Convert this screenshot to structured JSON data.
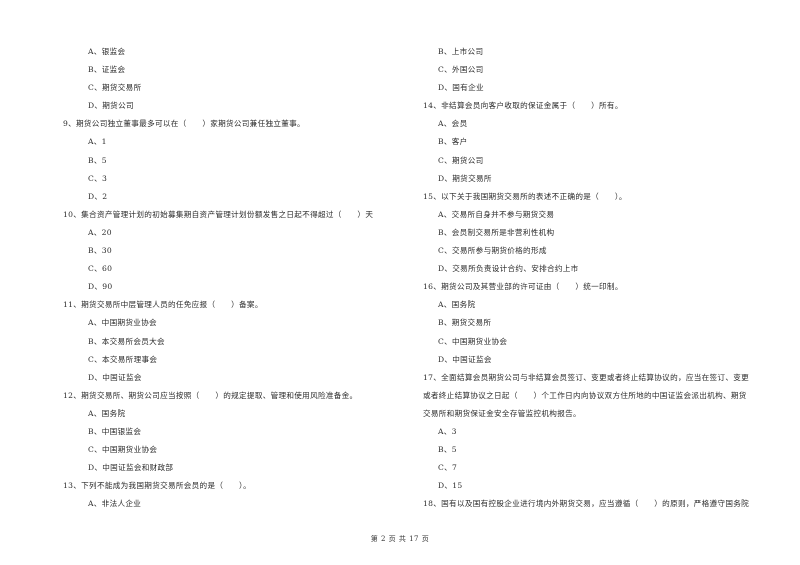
{
  "left_column": [
    {
      "type": "opt",
      "text": "A、银监会"
    },
    {
      "type": "opt",
      "text": "B、证监会"
    },
    {
      "type": "opt",
      "text": "C、期货交易所"
    },
    {
      "type": "opt",
      "text": "D、期货公司"
    },
    {
      "type": "q",
      "text": "9、期货公司独立董事最多可以在（　　）家期货公司兼任独立董事。"
    },
    {
      "type": "opt",
      "text": "A、1"
    },
    {
      "type": "opt",
      "text": "B、5"
    },
    {
      "type": "opt",
      "text": "C、3"
    },
    {
      "type": "opt",
      "text": "D、2"
    },
    {
      "type": "q",
      "text": "10、集合资产管理计划的初始募集期自资产管理计划份额发售之日起不得超过（　　）天"
    },
    {
      "type": "opt",
      "text": "A、20"
    },
    {
      "type": "opt",
      "text": "B、30"
    },
    {
      "type": "opt",
      "text": "C、60"
    },
    {
      "type": "opt",
      "text": "D、90"
    },
    {
      "type": "q",
      "text": "11、期货交易所中层管理人员的任免应报（　　）备案。"
    },
    {
      "type": "opt",
      "text": "A、中国期货业协会"
    },
    {
      "type": "opt",
      "text": "B、本交易所会员大会"
    },
    {
      "type": "opt",
      "text": "C、本交易所理事会"
    },
    {
      "type": "opt",
      "text": "D、中国证监会"
    },
    {
      "type": "q",
      "text": "12、期货交易所、期货公司应当按照（　　）的规定提取、管理和使用风险准备金。"
    },
    {
      "type": "opt",
      "text": "A、国务院"
    },
    {
      "type": "opt",
      "text": "B、中国银监会"
    },
    {
      "type": "opt",
      "text": "C、中国期货业协会"
    },
    {
      "type": "opt",
      "text": "D、中国证监会和财政部"
    },
    {
      "type": "q",
      "text": "13、下列不能成为我国期货交易所会员的是（　　）。"
    },
    {
      "type": "opt",
      "text": "A、非法人企业"
    }
  ],
  "right_column": [
    {
      "type": "opt",
      "text": "B、上市公司"
    },
    {
      "type": "opt",
      "text": "C、外国公司"
    },
    {
      "type": "opt",
      "text": "D、国有企业"
    },
    {
      "type": "q",
      "text": "14、非结算会员向客户收取的保证金属于（　　）所有。"
    },
    {
      "type": "opt",
      "text": "A、会员"
    },
    {
      "type": "opt",
      "text": "B、客户"
    },
    {
      "type": "opt",
      "text": "C、期货公司"
    },
    {
      "type": "opt",
      "text": "D、期货交易所"
    },
    {
      "type": "q",
      "text": "15、以下关于我国期货交易所的表述不正确的是（　　）。"
    },
    {
      "type": "opt",
      "text": "A、交易所自身并不参与期货交易"
    },
    {
      "type": "opt",
      "text": "B、会员制交易所是非营利性机构"
    },
    {
      "type": "opt",
      "text": "C、交易所参与期货价格的形成"
    },
    {
      "type": "opt",
      "text": "D、交易所负责设计合约、安排合约上市"
    },
    {
      "type": "q",
      "text": "16、期货公司及其营业部的许可证由（　　）统一印制。"
    },
    {
      "type": "opt",
      "text": "A、国务院"
    },
    {
      "type": "opt",
      "text": "B、期货交易所"
    },
    {
      "type": "opt",
      "text": "C、中国期货业协会"
    },
    {
      "type": "opt",
      "text": "D、中国证监会"
    },
    {
      "type": "q",
      "text": "17、全面结算会员期货公司与非结算会员签订、变更或者终止结算协议的，应当在签订、变更"
    },
    {
      "type": "q",
      "text": "或者终止结算协议之日起（　　）个工作日内向协议双方住所地的中国证监会派出机构、期货"
    },
    {
      "type": "q",
      "text": "交易所和期货保证金安全存管监控机构报告。"
    },
    {
      "type": "opt",
      "text": "A、3"
    },
    {
      "type": "opt",
      "text": "B、5"
    },
    {
      "type": "opt",
      "text": "C、7"
    },
    {
      "type": "opt",
      "text": "D、15"
    },
    {
      "type": "q",
      "text": "18、国有以及国有控股企业进行境内外期货交易，应当遵循（　　）的原则，严格遵守国务院"
    }
  ],
  "footer": "第 2 页 共 17 页"
}
